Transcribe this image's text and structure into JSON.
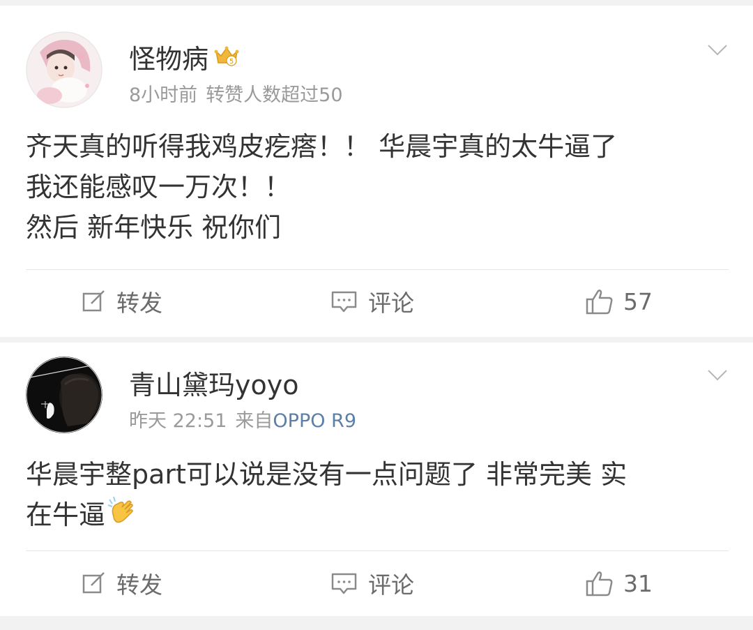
{
  "comments": [
    {
      "username": "怪物病",
      "level_badge": "crown-level-5-icon",
      "time": "8小时前",
      "note": "转赞人数超过50",
      "source_prefix": "",
      "source": "",
      "lines": [
        "齐天真的听得我鸡皮疙瘩！！ 华晨宇真的太牛逼了",
        "我还能感叹一万次！！",
        "然后 新年快乐 祝你们"
      ],
      "actions": {
        "repost": "转发",
        "comment": "评论",
        "likes": "57"
      }
    },
    {
      "username": "青山黛玛yoyo",
      "time": "昨天 22:51",
      "note": "",
      "source_prefix": "来自",
      "source": "OPPO R9",
      "lines": [
        "华晨宇整part可以说是没有一点问题了 非常完美 实",
        "在牛逼"
      ],
      "emoji": "clapping-hands-icon",
      "actions": {
        "repost": "转发",
        "comment": "评论",
        "likes": "31"
      }
    }
  ],
  "colors": {
    "background": "#f2f2f2",
    "card": "#ffffff",
    "text": "#333333",
    "meta": "#9a9a9a",
    "link": "#5b7fa6",
    "crown": "#f0b73a"
  }
}
